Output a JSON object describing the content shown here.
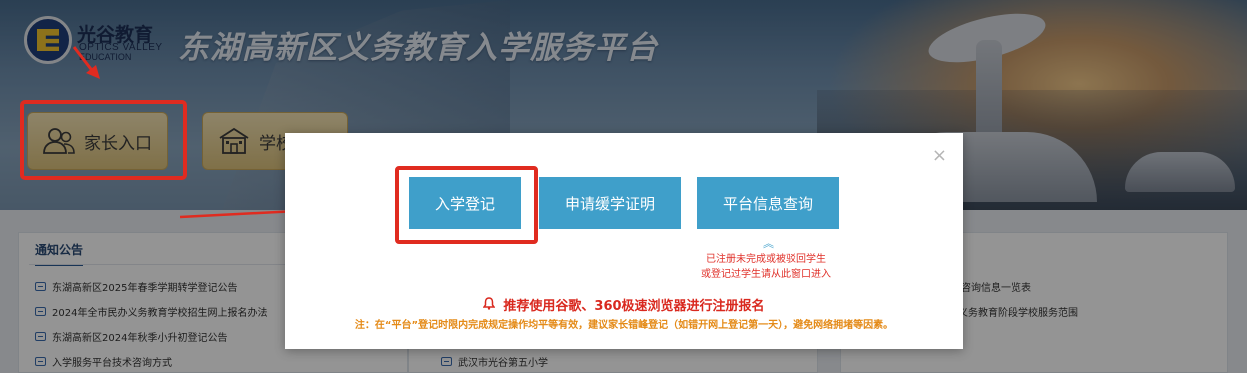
{
  "header": {
    "brand_cn": "光谷教育",
    "brand_en_line1": "OPTICS VALLEY",
    "brand_en_line2": "EDUCATION",
    "site_title": "东湖高新区义务教育入学服务平台"
  },
  "entries": {
    "parent_label": "家长入口",
    "student_label": "学校"
  },
  "panels": {
    "left": {
      "title": "通知公告",
      "items": [
        "东湖高新区2025年春季学期转学登记公告",
        "2024年全市民办义务教育学校招生网上报名办法",
        "东湖高新区2024年秋季小升初登记公告",
        "入学服务平台技术咨询方式"
      ]
    },
    "mid": {
      "items": [
        "武汉市光谷第五小学"
      ]
    },
    "right": {
      "items": [
        "咨询信息一览表",
        "义务教育阶段学校服务范围"
      ]
    }
  },
  "modal": {
    "close_glyph": "×",
    "buttons": {
      "register": "入学登记",
      "defer": "申请缓学证明",
      "query": "平台信息查询"
    },
    "up_glyph": "︽",
    "hint_line1": "已注册未完成或被驳回学生",
    "hint_line2": "或登记过学生请从此窗口进入",
    "recommend": "推荐使用谷歌、360极速浏览器进行注册报名",
    "note": "注：在“平台”登记时限内完成规定操作均平等有效，建议家长错峰登记（如错开网上登记第一天），避免网络拥堵等因素。"
  },
  "colors": {
    "modal_button": "#3f9fca",
    "annotation_red": "#e02b20",
    "recommend_red": "#d9291f",
    "note_orange": "#e48a17",
    "entry_gold": "#dcc27d"
  }
}
